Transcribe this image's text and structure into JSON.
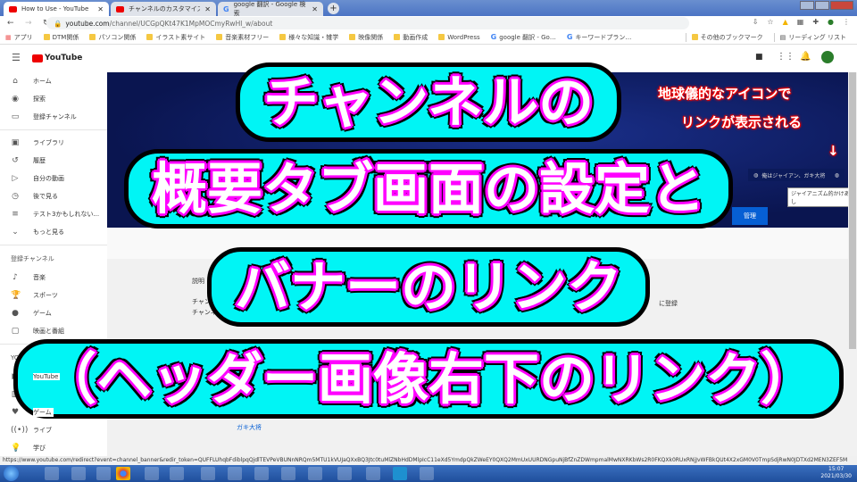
{
  "browser": {
    "tabs": [
      {
        "title": "How to Use - YouTube",
        "icon": "youtube-icon",
        "active": true
      },
      {
        "title": "チャンネルのカスタマイズ - Yo",
        "icon": "youtube-icon",
        "active": false
      },
      {
        "title": "google 翻訳 - Google 検索",
        "icon": "google-icon",
        "active": false
      }
    ],
    "url_domain": "youtube.com",
    "url_path": "/channel/UCGpQKt47K1MpMOCmyRwHl_w/about",
    "bookmarks": [
      "アプリ",
      "DTM関係",
      "パソコン関係",
      "イラスト素サイト",
      "音楽素材フリー",
      "様々な知識・雑学",
      "映像関係",
      "動画作成",
      "WordPress",
      "google 翻訳 - Go…",
      "キーワードプラン…"
    ],
    "other_bookmarks": "その他のブックマーク",
    "reading_list": "リーディング リスト"
  },
  "youtube": {
    "logo": "YouTube",
    "sidebar": {
      "main": [
        {
          "label": "ホーム",
          "icon": "home-icon"
        },
        {
          "label": "探索",
          "icon": "explore-icon"
        },
        {
          "label": "登録チャンネル",
          "icon": "subscriptions-icon"
        }
      ],
      "library": [
        {
          "label": "ライブラリ",
          "icon": "library-icon"
        },
        {
          "label": "履歴",
          "icon": "history-icon"
        },
        {
          "label": "自分の動画",
          "icon": "my-videos-icon"
        },
        {
          "label": "後で見る",
          "icon": "watch-later-icon"
        },
        {
          "label": "テスト3かもしれない...",
          "icon": "playlist-icon"
        },
        {
          "label": "もっと見る",
          "icon": "chevron-down-icon"
        }
      ],
      "subs_heading": "登録チャンネル",
      "subs": [
        {
          "label": "音楽",
          "icon": "music-icon"
        },
        {
          "label": "スポーツ",
          "icon": "sports-icon"
        },
        {
          "label": "ゲーム",
          "icon": "gaming-icon"
        },
        {
          "label": "映画と番組",
          "icon": "movies-icon"
        }
      ],
      "more_heading": "YOUTUBE の",
      "more": [
        {
          "label": "YouTube",
          "icon": "youtube-icon"
        },
        {
          "label": "映画",
          "icon": "film-icon"
        },
        {
          "label": "ゲーム",
          "icon": "gaming-icon"
        },
        {
          "label": "ライブ",
          "icon": "live-icon"
        },
        {
          "label": "学び",
          "icon": "learning-icon"
        }
      ]
    },
    "banner_link_text": "俺はジャイアン、ガキ大将",
    "tooltip": "ジャイアニズム的かけあし",
    "manage_button": "管理",
    "description_label": "説明",
    "channel_line1": "チャンネル",
    "channel_line2": "チャンネル",
    "registered": "に登録",
    "link_fragment": "ガキ大将"
  },
  "annotation": {
    "line1": "地球儀的なアイコンで",
    "line2": "リンクが表示される",
    "arrow": "↓"
  },
  "overlay_title": {
    "lines": [
      "チャンネルの",
      "概要タブ画面の設定と",
      "バナーのリンク",
      "（ヘッダー画像右下のリンク）"
    ],
    "colors": {
      "fill": "#ffffff",
      "stroke": "#ff00ff",
      "outline": "#000000",
      "glow": "#00f5f5"
    }
  },
  "status_url": "https://www.youtube.com/redirect?event=channel_banner&redir_token=QUFFLUhqbFdiblpqQjdlTEVPeVBUNnNRQm5MTU1kVUJaQXxBQ3Jtc0tuMlZNbHdDMlpIcC11eXd5YmdpQkZWeEY0QXQ2MmUxUURDNGpuNjBfZnZDWmpmalMwNXRKbWs2R0FKQXk0RUxRNjJvWFBkQUt4X2xGM0V0TmpSdjRwN0JDTXd2MEN3ZEF5M",
  "taskbar": {
    "time": "15:07",
    "date": "2021/03/30"
  }
}
